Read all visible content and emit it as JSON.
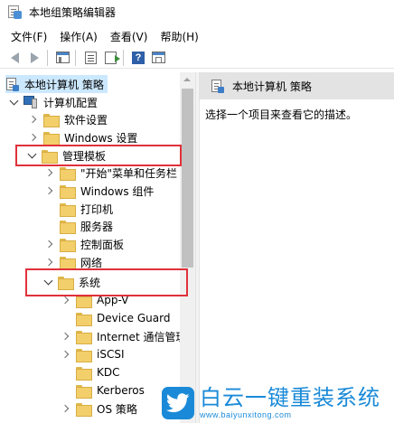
{
  "window": {
    "title": "本地组策略编辑器"
  },
  "menu": [
    "文件(F)",
    "操作(A)",
    "查看(V)",
    "帮助(H)"
  ],
  "tree": {
    "root": "本地计算机 策略",
    "computer_config": "计算机配置",
    "software_settings": "软件设置",
    "windows_settings": "Windows 设置",
    "admin_templates": "管理模板",
    "start_menu": "\"开始\"菜单和任务栏",
    "windows_components": "Windows 组件",
    "printers": "打印机",
    "servers": "服务器",
    "control_panel": "控制面板",
    "network": "网络",
    "system": "系统",
    "appv": "App-V",
    "device_guard": "Device Guard",
    "internet_comm": "Internet 通信管理",
    "iscsi": "iSCSI",
    "kdc": "KDC",
    "kerberos": "Kerberos",
    "os_policy": "OS 策略"
  },
  "right_pane": {
    "title": "本地计算机 策略",
    "description": "选择一个项目来查看它的描述。"
  },
  "watermark": {
    "title": "白云一键重装系统",
    "url": "www.baiyunxitong.com"
  },
  "colors": {
    "highlight_box": "#e0313a",
    "selection": "#cce8ff",
    "brand": "#1a8ad8"
  }
}
